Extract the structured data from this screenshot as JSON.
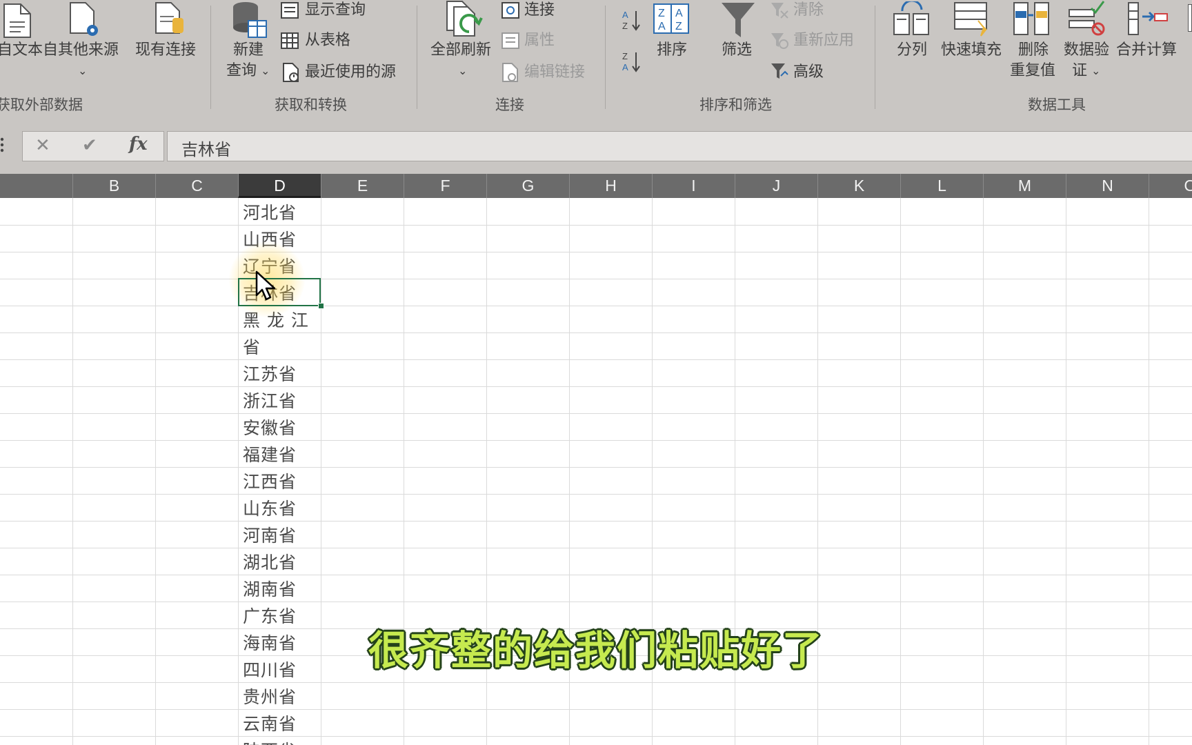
{
  "ribbon": {
    "get_external": {
      "from_text": "自文本",
      "other_sources": "自其他来源",
      "existing_conn": "现有连接",
      "group": "获取外部数据"
    },
    "get_transform": {
      "new_query_1": "新建",
      "new_query_2": "查询",
      "show_queries": "显示查询",
      "from_table": "从表格",
      "recent_sources": "最近使用的源",
      "group": "获取和转换"
    },
    "connections": {
      "refresh_all": "全部刷新",
      "connections": "连接",
      "properties": "属性",
      "edit_links": "编辑链接",
      "group": "连接"
    },
    "sort_filter": {
      "sort": "排序",
      "filter": "筛选",
      "clear": "清除",
      "reapply": "重新应用",
      "advanced": "高级",
      "group": "排序和筛选"
    },
    "data_tools": {
      "text_to_columns": "分列",
      "flash_fill": "快速填充",
      "remove_dup_1": "删除",
      "remove_dup_2": "重复值",
      "validation_1": "数据验",
      "validation_2": "证",
      "consolidate": "合并计算",
      "group": "数据工具"
    }
  },
  "formula_bar": {
    "cancel_glyph": "✕",
    "enter_glyph": "✔",
    "fx": "fx",
    "value": "吉林省"
  },
  "columns": [
    "B",
    "C",
    "D",
    "E",
    "F",
    "G",
    "H",
    "I",
    "J",
    "K",
    "L",
    "M",
    "N",
    "O"
  ],
  "selected_column": "D",
  "cells": [
    "河北省",
    "山西省",
    "辽宁省",
    "吉林省",
    "黑 龙 江",
    "省",
    "江苏省",
    "浙江省",
    "安徽省",
    "福建省",
    "江西省",
    "山东省",
    "河南省",
    "湖北省",
    "湖南省",
    "广东省",
    "海南省",
    "四川省",
    "贵州省",
    "云南省",
    "陕西省"
  ],
  "subtitle": "很齐整的给我们粘贴好了",
  "colors": {
    "ribbon_bg": "#c9c6c3",
    "header_bg": "#6b6b6b",
    "selection_border": "#217346",
    "subtitle_fill": "#c6ea4f",
    "subtitle_outline": "#24421a"
  }
}
